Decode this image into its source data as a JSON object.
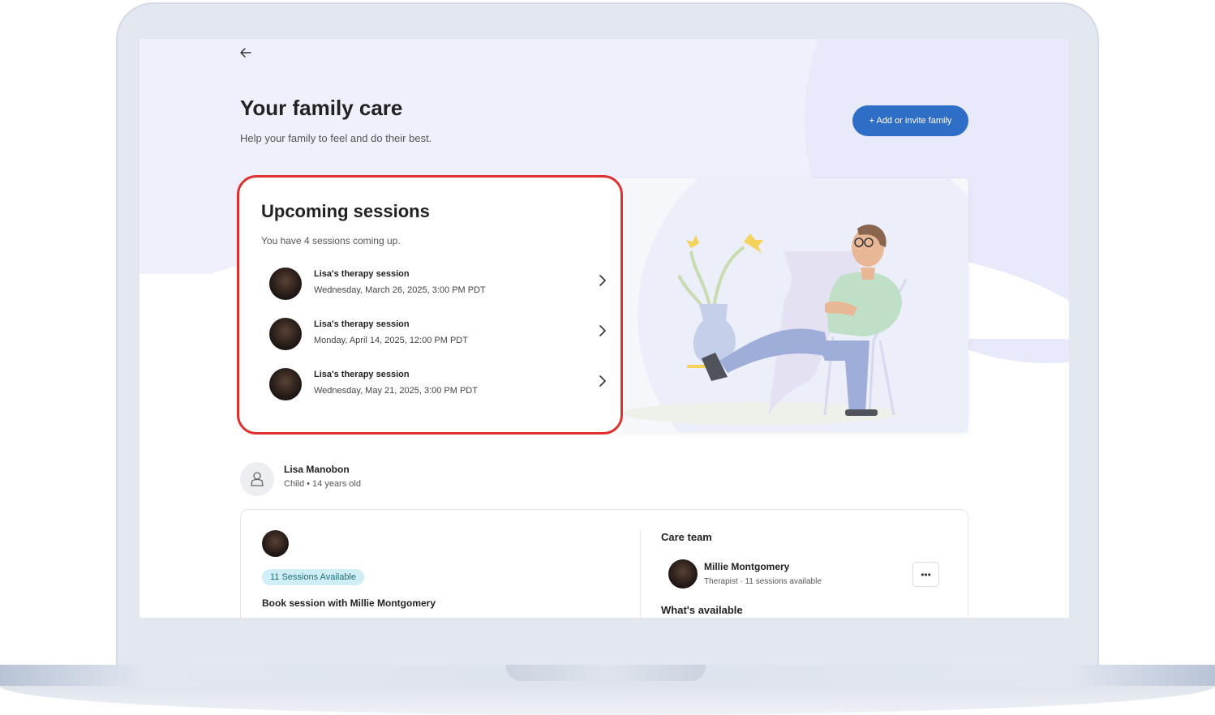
{
  "header": {
    "title": "Your family care",
    "subtitle": "Help your family to feel and do their best.",
    "add_button_label": "+ Add or invite family"
  },
  "upcoming": {
    "title": "Upcoming sessions",
    "subtitle": "You have 4 sessions coming up.",
    "sessions": [
      {
        "title": "Lisa's therapy session",
        "date": "Wednesday, March 26, 2025, 3:00 PM PDT"
      },
      {
        "title": "Lisa's therapy session",
        "date": "Monday, April 14, 2025, 12:00 PM PDT"
      },
      {
        "title": "Lisa's therapy session",
        "date": "Wednesday, May 21, 2025, 3:00 PM PDT"
      }
    ]
  },
  "member": {
    "name": "Lisa Manobon",
    "meta": "Child • 14 years old"
  },
  "booking": {
    "badge": "11 Sessions Available",
    "book_label": "Book session with Millie Montgomery"
  },
  "care_team": {
    "title": "Care team",
    "therapist_name": "Millie Montgomery",
    "therapist_meta": "Therapist · 11 sessions available",
    "more_label": "•••",
    "available_title": "What's available"
  },
  "colors": {
    "accent": "#2f6ec6",
    "highlight": "#e03131",
    "badge_bg": "#cfeef5"
  }
}
